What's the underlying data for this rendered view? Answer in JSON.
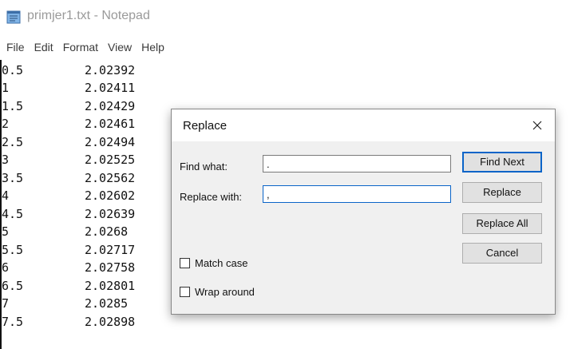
{
  "window": {
    "title": "primjer1.txt - Notepad"
  },
  "menu": [
    "File",
    "Edit",
    "Format",
    "View",
    "Help"
  ],
  "document": {
    "rows": [
      [
        "0.5",
        "2.02392"
      ],
      [
        "1",
        "2.02411"
      ],
      [
        "1.5",
        "2.02429"
      ],
      [
        "2",
        "2.02461"
      ],
      [
        "2.5",
        "2.02494"
      ],
      [
        "3",
        "2.02525"
      ],
      [
        "3.5",
        "2.02562"
      ],
      [
        "4",
        "2.02602"
      ],
      [
        "4.5",
        "2.02639"
      ],
      [
        "5",
        "2.0268"
      ],
      [
        "5.5",
        "2.02717"
      ],
      [
        "6",
        "2.02758"
      ],
      [
        "6.5",
        "2.02801"
      ],
      [
        "7",
        "2.0285"
      ],
      [
        "7.5",
        "2.02898"
      ]
    ]
  },
  "dialog": {
    "title": "Replace",
    "find_label": "Find what:",
    "find_value": ".",
    "replace_label": "Replace with:",
    "replace_value": ",",
    "buttons": {
      "find_next": "Find Next",
      "replace": "Replace",
      "replace_all": "Replace All",
      "cancel": "Cancel"
    },
    "match_case_label": "Match case",
    "match_case_checked": false,
    "wrap_around_label": "Wrap around",
    "wrap_around_checked": false
  },
  "icons": {
    "app": "notepad-icon",
    "close": "close-icon"
  },
  "colors": {
    "accent": "#0a64c8"
  }
}
